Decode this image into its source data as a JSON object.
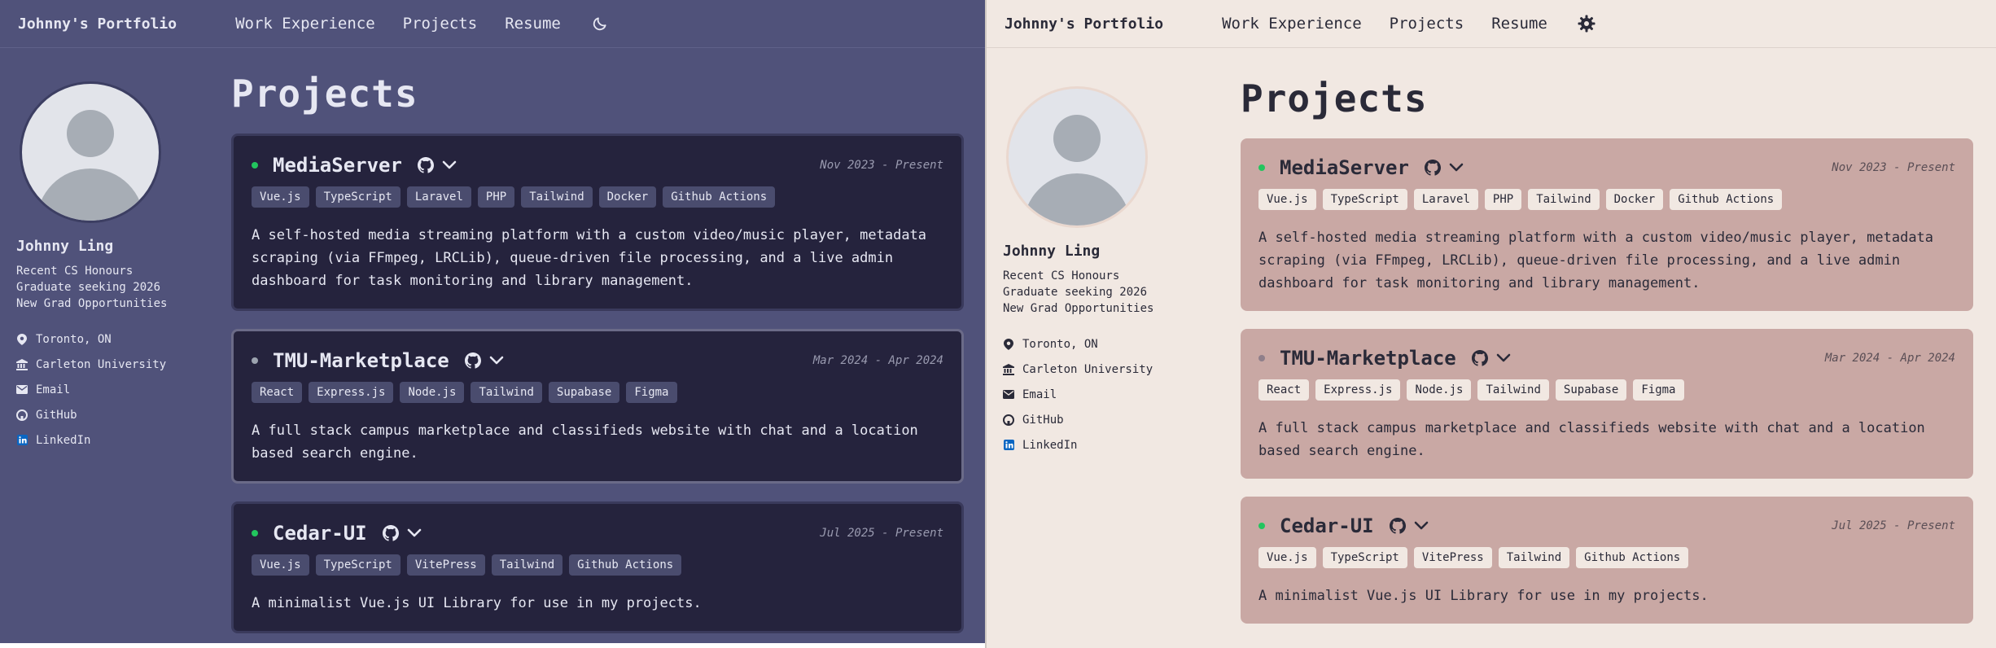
{
  "brand": "Johnny's Portfolio",
  "nav": [
    "Work Experience",
    "Projects",
    "Resume"
  ],
  "theme_toggle": {
    "dark": "moon-icon",
    "light": "gear-icon"
  },
  "profile": {
    "name": "Johnny Ling",
    "bio": "Recent CS Honours Graduate seeking 2026 New Grad Opportunities",
    "contacts": [
      {
        "label": "Toronto, ON",
        "icon": "map-pin-icon"
      },
      {
        "label": "Carleton University",
        "icon": "university-icon"
      },
      {
        "label": "Email",
        "icon": "mail-icon"
      },
      {
        "label": "GitHub",
        "icon": "github-icon"
      },
      {
        "label": "LinkedIn",
        "icon": "linkedin-icon"
      }
    ]
  },
  "page_title": "Projects",
  "projects": [
    {
      "title": "MediaServer",
      "status_color": "#22c55e",
      "date": "Nov 2023 - Present",
      "tags": [
        "Vue.js",
        "TypeScript",
        "Laravel",
        "PHP",
        "Tailwind",
        "Docker",
        "Github Actions"
      ],
      "description": "A self-hosted media streaming platform with a custom video/music player, metadata scraping (via FFmpeg, LRCLib), queue-driven file processing, and a live admin dashboard for task monitoring and library management."
    },
    {
      "title": "TMU-Marketplace",
      "status_color": "#9ca3af",
      "date": "Mar 2024 - Apr 2024",
      "tags": [
        "React",
        "Express.js",
        "Node.js",
        "Tailwind",
        "Supabase",
        "Figma"
      ],
      "description": "A full stack campus marketplace and classifieds website with chat and a location based search engine."
    },
    {
      "title": "Cedar-UI",
      "status_color": "#22c55e",
      "date": "Jul 2025 - Present",
      "tags": [
        "Vue.js",
        "TypeScript",
        "VitePress",
        "Tailwind",
        "Github Actions"
      ],
      "description": "A minimalist Vue.js UI Library for use in my projects."
    }
  ],
  "colors": {
    "dark_bg": "#50527a",
    "dark_card": "#25233d",
    "light_bg": "#f1e8e2",
    "light_card": "#c9a8a4",
    "accent_linkedin": "#0a66c2"
  }
}
